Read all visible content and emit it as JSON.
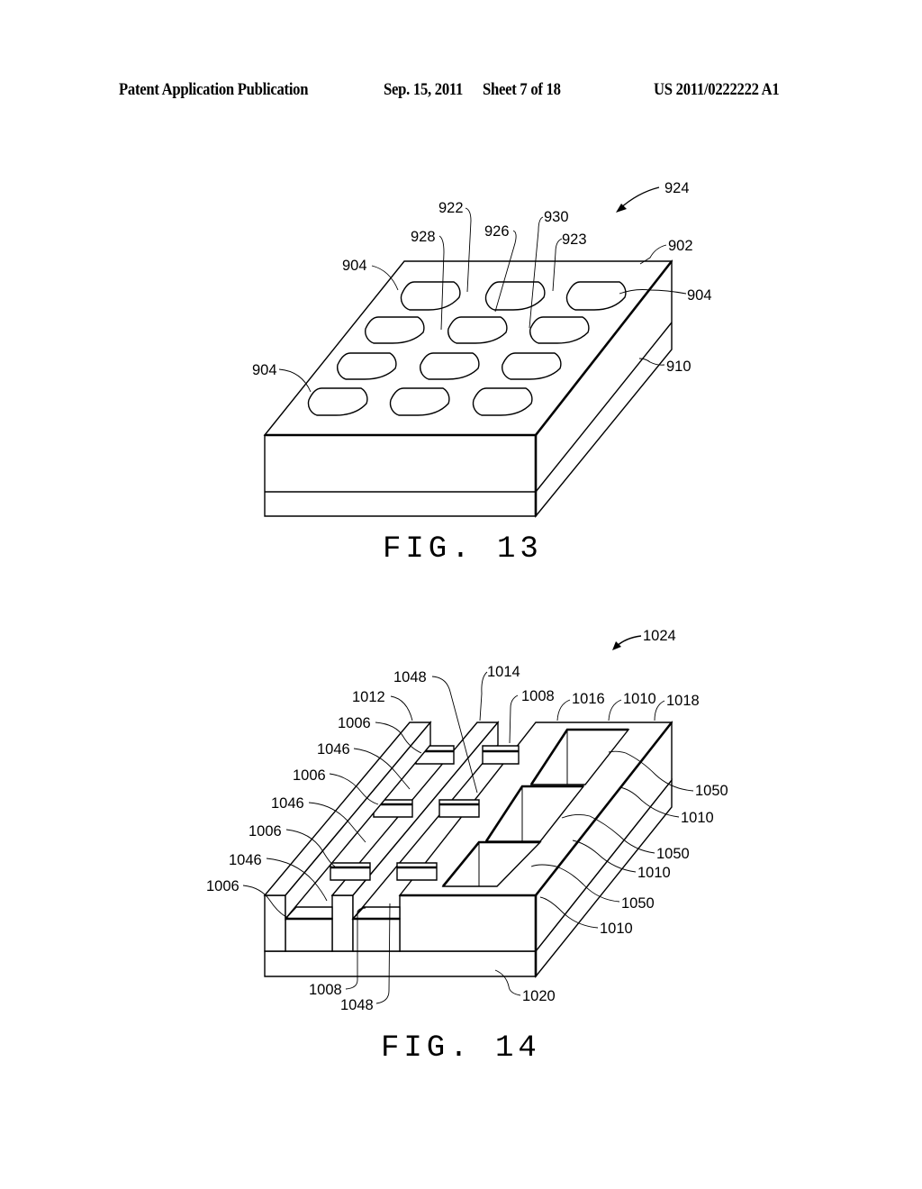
{
  "header": {
    "publication": "Patent Application Publication",
    "date": "Sep. 15, 2011",
    "sheet": "Sheet 7 of 18",
    "number": "US 2011/0222222 A1"
  },
  "figures": [
    {
      "caption": "FIG. 13",
      "reference": "924",
      "labels": {
        "l922": "922",
        "l930": "930",
        "l928": "928",
        "l926": "926",
        "l923": "923",
        "l902": "902",
        "l904_top": "904",
        "l904_right": "904",
        "l904_left": "904",
        "l910": "910"
      },
      "elements": [
        "substrate block",
        "top layer",
        "12 elongated openings (4 rows × 3)"
      ]
    },
    {
      "caption": "FIG. 14",
      "reference": "1024",
      "labels": {
        "l1048_top": "1048",
        "l1014": "1014",
        "l1012": "1012",
        "l1008_top": "1008",
        "l1016": "1016",
        "l1010_top": "1010",
        "l1018": "1018",
        "l1006_a": "1006",
        "l1046_a": "1046",
        "l1006_b": "1006",
        "l1046_b": "1046",
        "l1006_c": "1006",
        "l1046_c": "1046",
        "l1006_d": "1006",
        "l1050_a": "1050",
        "l1010_a": "1010",
        "l1050_b": "1050",
        "l1010_b": "1010",
        "l1050_c": "1050",
        "l1010_c": "1010",
        "l1008_bot": "1008",
        "l1048_bot": "1048",
        "l1020": "1020"
      },
      "elements": [
        "base layer 1020",
        "fins 1012 and 1014",
        "block 1016 with 3 square openings 1050"
      ]
    }
  ]
}
